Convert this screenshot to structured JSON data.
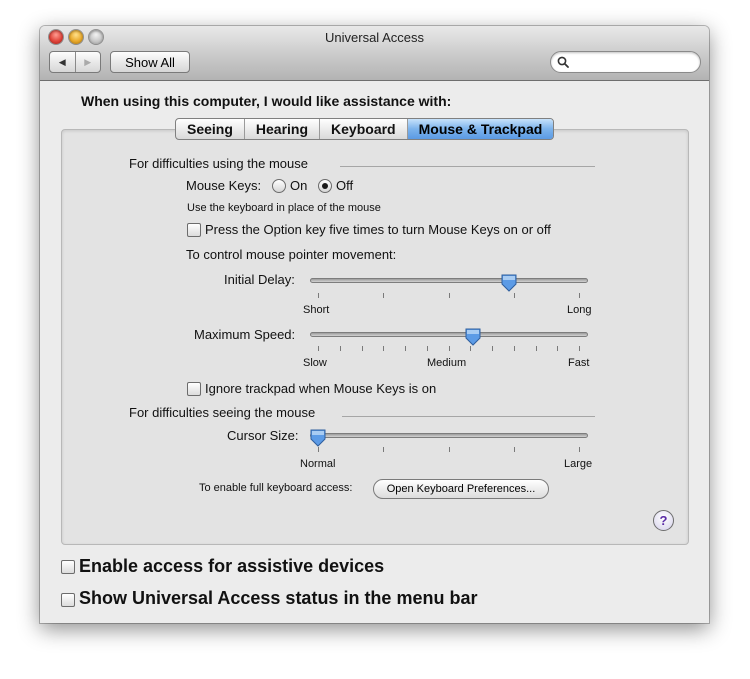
{
  "window": {
    "title": "Universal Access"
  },
  "toolbar": {
    "back_icon": "triangle-left",
    "forward_icon": "triangle-right",
    "show_all_label": "Show All",
    "search_value": "",
    "search_icon": "magnifier"
  },
  "heading": "When using this computer, I would like assistance with:",
  "tabs": [
    {
      "label": "Seeing",
      "selected": false
    },
    {
      "label": "Hearing",
      "selected": false
    },
    {
      "label": "Keyboard",
      "selected": false
    },
    {
      "label": "Mouse & Trackpad",
      "selected": true
    }
  ],
  "mouse_section": {
    "title": "For difficulties using the mouse",
    "mouse_keys_label": "Mouse Keys:",
    "on_label": "On",
    "off_label": "Off",
    "mouse_keys_value": "Off",
    "help_text": "Use the keyboard in place of the mouse",
    "option_key_label": "Press the Option key five times to turn Mouse Keys on or off",
    "option_key_checked": false,
    "pointer_movement_label": "To control mouse pointer movement:",
    "initial_delay": {
      "label": "Initial Delay:",
      "min_label": "Short",
      "max_label": "Long",
      "value_fraction": 0.73
    },
    "maximum_speed": {
      "label": "Maximum Speed:",
      "min_label": "Slow",
      "mid_label": "Medium",
      "max_label": "Fast",
      "value_fraction": 0.59
    },
    "ignore_trackpad_label": "Ignore trackpad when Mouse Keys is on",
    "ignore_trackpad_checked": false
  },
  "seeing_section": {
    "title": "For difficulties seeing the mouse",
    "cursor_size": {
      "label": "Cursor Size:",
      "min_label": "Normal",
      "max_label": "Large",
      "value_fraction": 0.0
    },
    "keyboard_access_label": "To enable full keyboard access:",
    "keyboard_prefs_button": "Open Keyboard Preferences..."
  },
  "help_button": "?",
  "bottom": {
    "assistive_label": "Enable access for assistive devices",
    "assistive_checked": false,
    "status_label": "Show Universal Access status in the menu bar",
    "status_checked": false
  },
  "colors": {
    "selected_tab": "#6aa6ea",
    "slider_thumb": "#5c9be6",
    "help_glyph": "#5a2aa6"
  }
}
